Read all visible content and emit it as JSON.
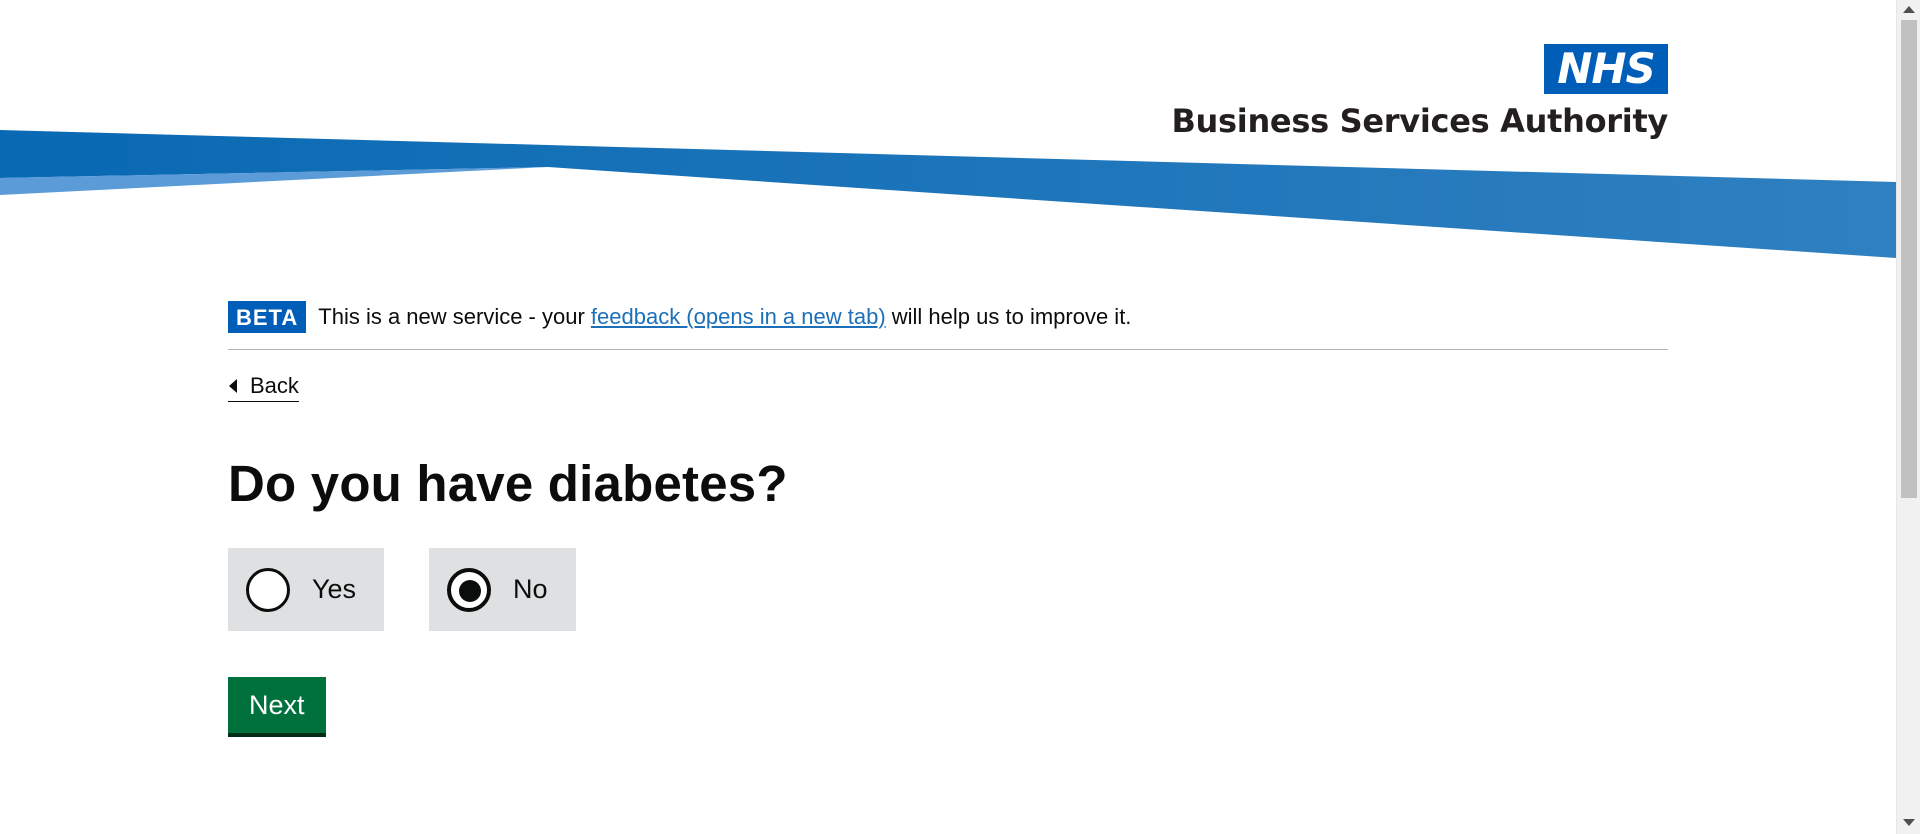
{
  "header": {
    "logo_text": "NHS",
    "org_name": "Business Services Authority",
    "colors": {
      "brand_blue": "#005eb8",
      "swoosh_dark": "#0e6fb8",
      "swoosh_light": "#5a9bd8"
    }
  },
  "phase_banner": {
    "tag": "BETA",
    "text_before": "This is a new service - your ",
    "link_text": "feedback (opens in a new tab)",
    "text_after": " will help us to improve it."
  },
  "back_link": {
    "label": "Back"
  },
  "question": {
    "title": "Do you have diabetes?",
    "options": [
      {
        "label": "Yes",
        "selected": false
      },
      {
        "label": "No",
        "selected": true
      }
    ]
  },
  "actions": {
    "next_label": "Next",
    "next_color": "#00703c"
  }
}
